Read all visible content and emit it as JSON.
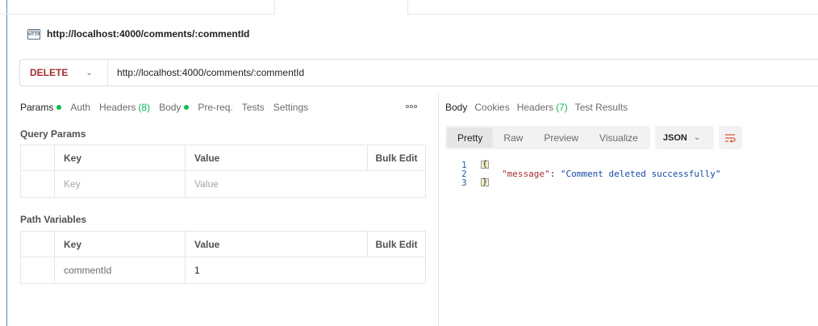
{
  "title": {
    "text": "http://localhost:4000/comments/:commentId",
    "icon": "http-icon"
  },
  "request": {
    "method": "DELETE",
    "url": "http://localhost:4000/comments/:commentId"
  },
  "request_tabs": [
    {
      "label": "Params",
      "dot": true
    },
    {
      "label": "Auth"
    },
    {
      "label": "Headers",
      "count": "(8)"
    },
    {
      "label": "Body",
      "dot": true
    },
    {
      "label": "Pre-req."
    },
    {
      "label": "Tests"
    },
    {
      "label": "Settings"
    }
  ],
  "query_params": {
    "title": "Query Params",
    "headers": {
      "key": "Key",
      "value": "Value",
      "bulk": "Bulk Edit"
    },
    "placeholder": {
      "key": "Key",
      "value": "Value"
    }
  },
  "path_variables": {
    "title": "Path Variables",
    "headers": {
      "key": "Key",
      "value": "Value",
      "bulk": "Bulk Edit"
    },
    "rows": [
      {
        "key": "commentId",
        "value": "1"
      }
    ]
  },
  "response_tabs": [
    {
      "label": "Body"
    },
    {
      "label": "Cookies"
    },
    {
      "label": "Headers",
      "count": "(7)"
    },
    {
      "label": "Test Results"
    }
  ],
  "format": {
    "modes": [
      "Pretty",
      "Raw",
      "Preview",
      "Visualize"
    ],
    "selected": "Pretty",
    "language": "JSON"
  },
  "response_body": {
    "line_numbers": [
      "1",
      "2",
      "3"
    ],
    "open": "{",
    "close": "}",
    "key": "\"message\"",
    "colon": ": ",
    "value": "\"Comment deleted successfully\""
  },
  "colors": {
    "accent_green": "#0cbb52",
    "method_red": "#a42e2e"
  }
}
